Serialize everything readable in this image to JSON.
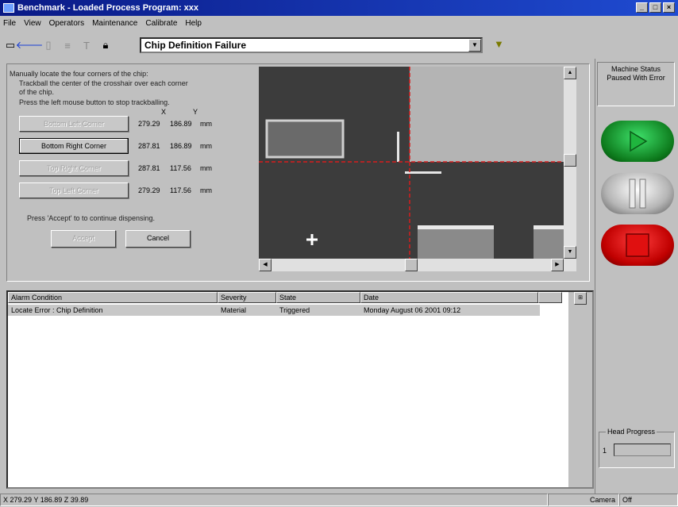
{
  "window": {
    "title": "Benchmark - Loaded Process Program: xxx"
  },
  "menu": [
    "File",
    "View",
    "Operators",
    "Maintenance",
    "Calibrate",
    "Help"
  ],
  "toolbar": {
    "combo_value": "Chip Definition Failure"
  },
  "instructions": {
    "line1": "Manually locate the four corners of the chip:",
    "line2": "Trackball the center of the crosshair over each corner",
    "line3": "of the chip.",
    "line4": "Press the left mouse button to stop trackballing.",
    "accept_text": "Press 'Accept' to to continue dispensing."
  },
  "columns": {
    "x": "X",
    "y": "Y"
  },
  "corners": [
    {
      "label": "Bottom Left Corner",
      "x": "279.29",
      "y": "186.89",
      "unit": "mm",
      "state": "disabled"
    },
    {
      "label": "Bottom Right Corner",
      "x": "287.81",
      "y": "186.89",
      "unit": "mm",
      "state": "active"
    },
    {
      "label": "Top Right Corner",
      "x": "287.81",
      "y": "117.56",
      "unit": "mm",
      "state": "disabled"
    },
    {
      "label": "Top Left Corner",
      "x": "279.29",
      "y": "117.56",
      "unit": "mm",
      "state": "disabled"
    }
  ],
  "buttons": {
    "accept": "Accept",
    "cancel": "Cancel"
  },
  "status": {
    "title": "Machine Status",
    "value": "Paused With Error"
  },
  "head_progress": {
    "label": "Head Progress",
    "number": "1"
  },
  "alarms": {
    "headers": [
      "Alarm Condition",
      "Severity",
      "State",
      "Date"
    ],
    "rows": [
      {
        "condition": "Locate Error : Chip Definition",
        "severity": "Material",
        "state": "Triggered",
        "date": "Monday August 06 2001 09:12"
      }
    ]
  },
  "statusbar": {
    "coords": "X 279.29   Y 186.89   Z 39.89",
    "camera": "Camera",
    "mode": "Off"
  }
}
